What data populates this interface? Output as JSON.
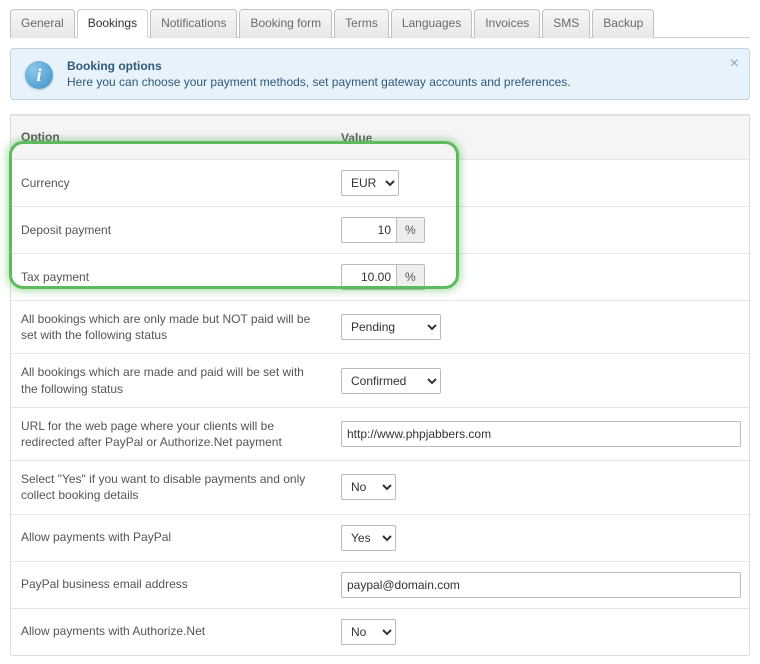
{
  "tabs": [
    "General",
    "Bookings",
    "Notifications",
    "Booking form",
    "Terms",
    "Languages",
    "Invoices",
    "SMS",
    "Backup"
  ],
  "active_tab_index": 1,
  "info": {
    "title": "Booking options",
    "desc": "Here you can choose your payment methods, set payment gateway accounts and preferences.",
    "icon_glyph": "i",
    "close_glyph": "×"
  },
  "headers": {
    "option": "Option",
    "value": "Value"
  },
  "suffix_percent": "%",
  "rows": {
    "currency": {
      "label": "Currency",
      "value": "EUR"
    },
    "deposit": {
      "label": "Deposit payment",
      "value": "10"
    },
    "tax": {
      "label": "Tax payment",
      "value": "10.00"
    },
    "status_unpaid": {
      "label": "All bookings which are only made but NOT paid will be set with the following status",
      "value": "Pending"
    },
    "status_paid": {
      "label": "All bookings which are made and paid will be set with the following status",
      "value": "Confirmed"
    },
    "redirect_url": {
      "label": "URL for the web page where your clients will be redirected after PayPal or Authorize.Net payment",
      "value": "http://www.phpjabbers.com"
    },
    "disable_pay": {
      "label": "Select \"Yes\" if you want to disable payments and only collect booking details",
      "value": "No"
    },
    "allow_paypal": {
      "label": "Allow payments with PayPal",
      "value": "Yes"
    },
    "paypal_email": {
      "label": "PayPal business email address",
      "value": "paypal@domain.com"
    },
    "allow_authnet": {
      "label": "Allow payments with Authorize.Net",
      "value": "No"
    }
  }
}
